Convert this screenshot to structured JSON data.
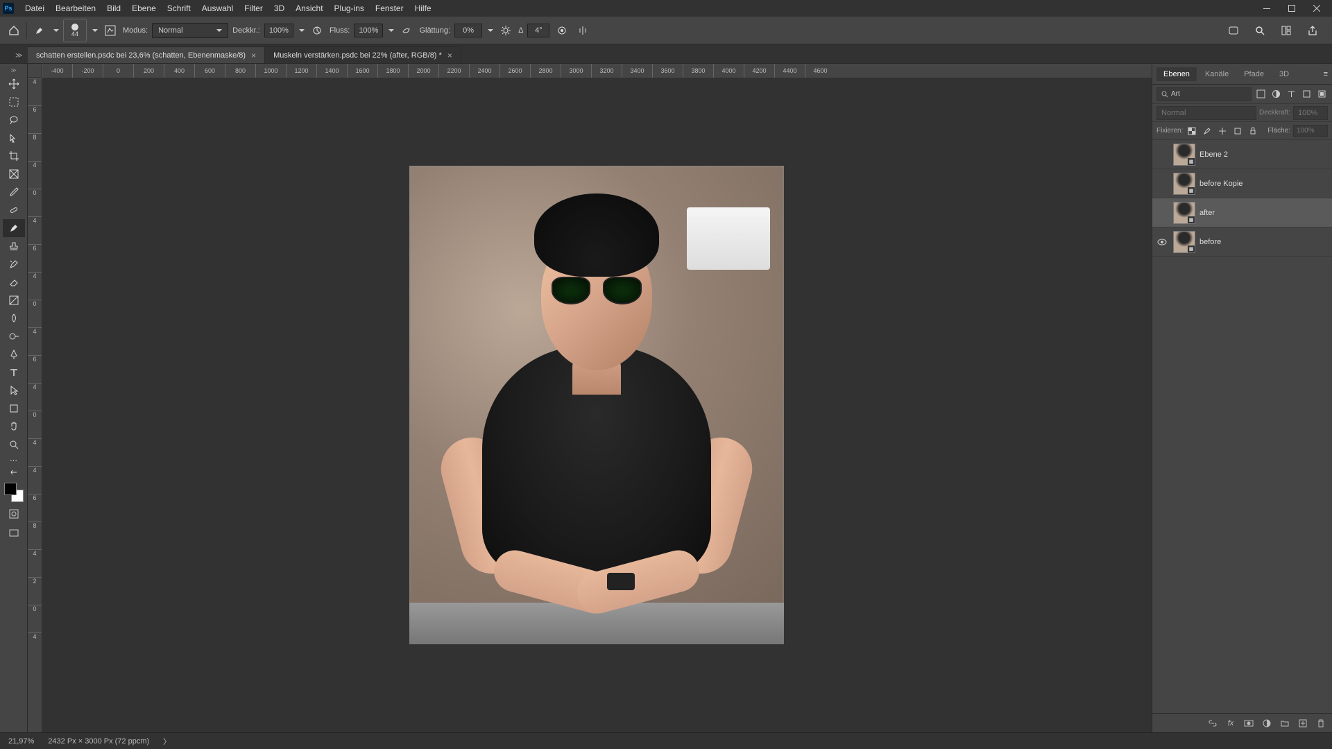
{
  "menu": [
    "Datei",
    "Bearbeiten",
    "Bild",
    "Ebene",
    "Schrift",
    "Auswahl",
    "Filter",
    "3D",
    "Ansicht",
    "Plug-ins",
    "Fenster",
    "Hilfe"
  ],
  "options": {
    "brush_size": "44",
    "modus_label": "Modus:",
    "modus_value": "Normal",
    "deckkr_label": "Deckkr.:",
    "deckkr_value": "100%",
    "fluss_label": "Fluss:",
    "fluss_value": "100%",
    "glaettung_label": "Glättung:",
    "glaettung_value": "0%",
    "angle_label": "Δ",
    "angle_value": "4°"
  },
  "tabs": [
    {
      "label": "schatten erstellen.psdc bei 23,6% (schatten, Ebenenmaske/8)",
      "active": false
    },
    {
      "label": "Muskeln verstärken.psdc bei 22% (after, RGB/8) *",
      "active": true
    }
  ],
  "rulerH": [
    "-400",
    "-200",
    "0",
    "200",
    "400",
    "600",
    "800",
    "1000",
    "1200",
    "1400",
    "1600",
    "1800",
    "2000",
    "2200",
    "2400",
    "2600",
    "2800",
    "3000",
    "3200",
    "3400",
    "3600",
    "3800",
    "4000",
    "4200",
    "4400",
    "4600"
  ],
  "rulerV": [
    "4",
    "6",
    "8",
    "4",
    "0",
    "4",
    "6",
    "4",
    "0",
    "4",
    "6",
    "4",
    "0",
    "4",
    "4",
    "6",
    "8",
    "4",
    "2",
    "0",
    "4"
  ],
  "panel": {
    "tabs": [
      "Ebenen",
      "Kanäle",
      "Pfade",
      "3D"
    ],
    "active_tab": 0,
    "search_label": "Art",
    "blend_mode": "Normal",
    "deckkraft_label": "Deckkraft:",
    "deckkraft_value": "100%",
    "fixieren_label": "Fixieren:",
    "flaeche_label": "Fläche:",
    "flaeche_value": "100%",
    "layers": [
      {
        "name": "Ebene 2",
        "visible": false,
        "selected": false
      },
      {
        "name": "before Kopie",
        "visible": false,
        "selected": false
      },
      {
        "name": "after",
        "visible": false,
        "selected": true
      },
      {
        "name": "before",
        "visible": true,
        "selected": false
      }
    ]
  },
  "status": {
    "zoom": "21,97%",
    "docinfo": "2432 Px × 3000 Px (72 ppcm)"
  }
}
